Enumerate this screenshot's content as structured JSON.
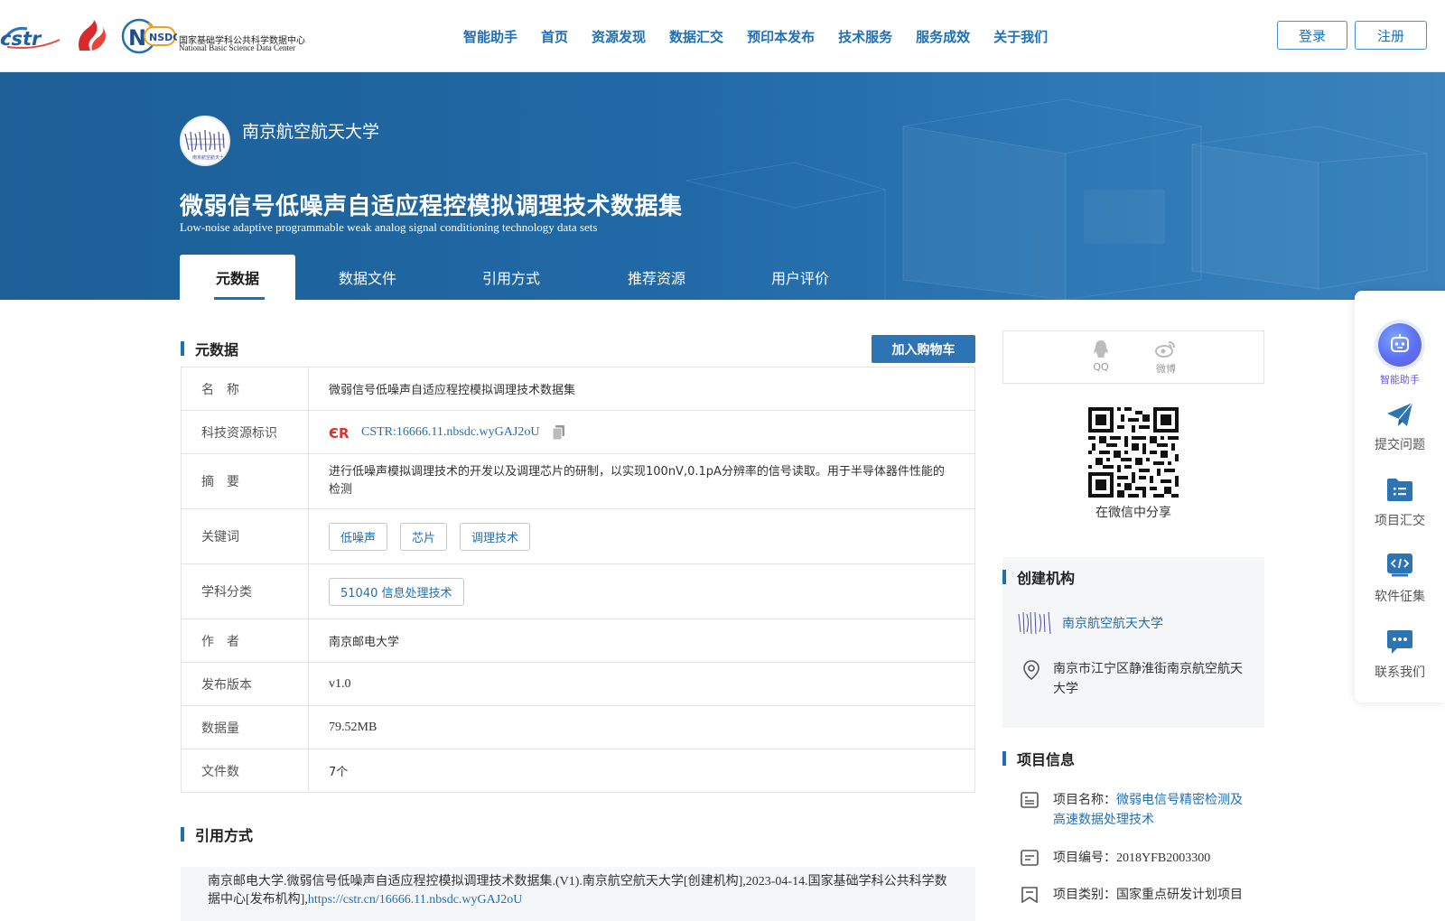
{
  "header": {
    "logo_nsdc_cn": "国家基础学科公共科学数据中心",
    "logo_nsdc_en": "National Basic Science Data Center",
    "logo_nsdc_abbr": "NSDC",
    "logo_cstr": "cstr",
    "nav": [
      "智能助手",
      "首页",
      "资源发现",
      "数据汇交",
      "预印本发布",
      "技术服务",
      "服务成效",
      "关于我们"
    ],
    "login": "登录",
    "register": "注册"
  },
  "hero": {
    "org_name": "南京航空航天大学",
    "title": "微弱信号低噪声自适应程控模拟调理技术数据集",
    "subtitle": "Low-noise adaptive programmable weak analog signal conditioning technology data sets",
    "tabs": [
      "元数据",
      "数据文件",
      "引用方式",
      "推荐资源",
      "用户评价"
    ]
  },
  "metadata": {
    "section_title": "元数据",
    "cart_button": "加入购物车",
    "rows": [
      {
        "key": "名　称",
        "value": "微弱信号低噪声自适应程控模拟调理技术数据集"
      },
      {
        "key": "科技资源标识",
        "value": "CSTR:16666.11.nbsdc.wyGAJ2oU"
      },
      {
        "key": "摘　要",
        "value": "进行低噪声模拟调理技术的开发以及调理芯片的研制，以实现100nV,0.1pA分辨率的信号读取。用于半导体器件性能的检测"
      },
      {
        "key": "关键词",
        "tags": [
          "低噪声",
          "芯片",
          "调理技术"
        ]
      },
      {
        "key": "学科分类",
        "tags": [
          "51040 信息处理技术"
        ]
      },
      {
        "key": "作　者",
        "value": "南京邮电大学"
      },
      {
        "key": "发布版本",
        "value": "v1.0"
      },
      {
        "key": "数据量",
        "value": "79.52MB"
      },
      {
        "key": "文件数",
        "value": "7个"
      }
    ]
  },
  "citation": {
    "section_title": "引用方式",
    "text": "南京邮电大学.微弱信号低噪声自适应程控模拟调理技术数据集.(V1).南京航空航天大学[创建机构],2023-04-14.国家基础学科公共科学数据中心[发布机构],",
    "link": "https://cstr.cn/16666.11.nbsdc.wyGAJ2oU"
  },
  "share": {
    "qq": "QQ",
    "weibo": "微博",
    "wechat_caption": "在微信中分享"
  },
  "creator": {
    "section_title": "创建机构",
    "name": "南京航空航天大学",
    "address": "南京市江宁区静淮街南京航空航天大学"
  },
  "project": {
    "section_title": "项目信息",
    "name_label": "项目名称：",
    "name_value": "微弱电信号精密检测及高速数据处理技术",
    "code_label": "项目编号：",
    "code_value": "2018YFB2003300",
    "type_label": "项目类别：",
    "type_value": "国家重点研发计划项目"
  },
  "float_panel": {
    "items": [
      "智能助手",
      "提交问题",
      "项目汇交",
      "软件征集",
      "联系我们"
    ]
  },
  "colors": {
    "primary": "#1f6fb5",
    "hero_bg": "#1d5f97",
    "button": "#2c74b3"
  }
}
